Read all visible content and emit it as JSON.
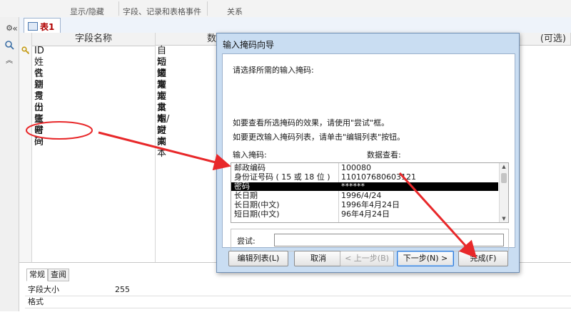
{
  "ribbon": {
    "groups": [
      "显示/隐藏",
      "字段、记录和表格事件",
      "关系"
    ]
  },
  "nav": {
    "shutter_glyph": "«"
  },
  "tab": {
    "label": "表1"
  },
  "grid": {
    "headers": {
      "field_name": "字段名称",
      "data_type": "数据类",
      "description": "(可选)"
    },
    "rows": [
      {
        "name": "ID",
        "type": "自动编号",
        "primary_key": true
      },
      {
        "name": "姓名",
        "type": "短文本"
      },
      {
        "name": "性别",
        "type": "短文本"
      },
      {
        "name": "籍贯",
        "type": "短文本"
      },
      {
        "name": "身份证",
        "type": "短文本"
      },
      {
        "name": "出生时间",
        "type": "日期/时间"
      },
      {
        "name": "账号",
        "type": "短文本"
      },
      {
        "name": "密码",
        "type": "短文本"
      }
    ]
  },
  "properties": {
    "tabs": [
      "常规",
      "查阅"
    ],
    "rows": [
      {
        "label": "字段大小",
        "value": "255"
      },
      {
        "label": "格式",
        "value": ""
      }
    ]
  },
  "dialog": {
    "title": "输入掩码向导",
    "prompt": "请选择所需的输入掩码:",
    "hint1": "如要查看所选掩码的效果，请使用\"尝试\"框。",
    "hint2": "如要更改输入掩码列表，请单击\"编辑列表\"按钮。",
    "col_mask": "输入掩码:",
    "col_view": "数据查看:",
    "masks": [
      {
        "name": "邮政编码",
        "view": "100080"
      },
      {
        "name": "身份证号码 ( 15 或 18 位 )",
        "view": "110107680603121"
      },
      {
        "name": "密码",
        "view": "******",
        "selected": true
      },
      {
        "name": "长日期",
        "view": "1996/4/24"
      },
      {
        "name": "长日期(中文)",
        "view": "1996年4月24日"
      },
      {
        "name": "短日期(中文)",
        "view": "96年4月24日"
      }
    ],
    "try_label": "尝试:",
    "try_value": "",
    "buttons": {
      "edit_list": "编辑列表(L)",
      "cancel": "取消",
      "back": "< 上一步(B)",
      "next": "下一步(N) >",
      "finish": "完成(F)"
    }
  },
  "colors": {
    "annotation": "#e8282a",
    "dialog_frame": "#c9ddf2",
    "selection": "#000000"
  }
}
